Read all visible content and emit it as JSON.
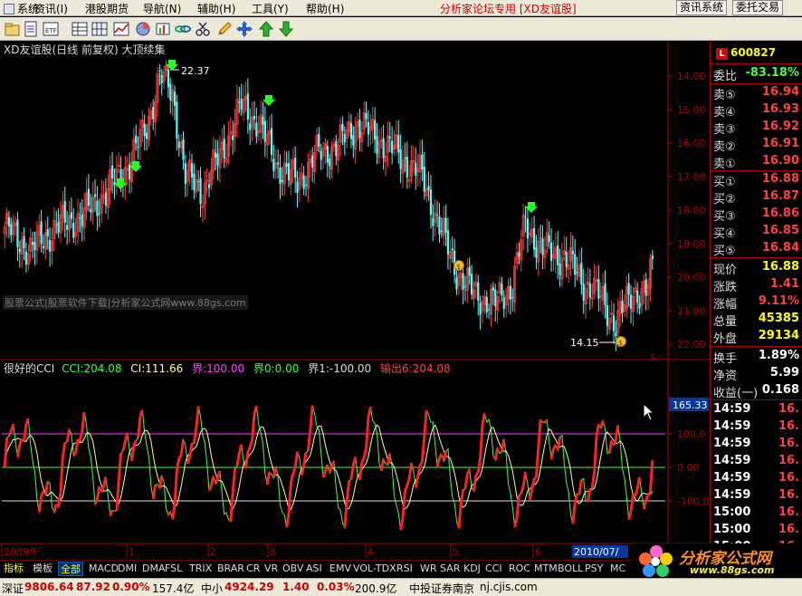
{
  "menu": {
    "items": [
      "系统",
      "资讯(I)",
      "港股期货",
      "导航(N)",
      "辅助(H)",
      "工具(Y)",
      "帮助(H)"
    ],
    "forum_text": "分析家论坛专用 [XD友谊股]",
    "right_buttons": [
      "资讯系统",
      "委托交易"
    ]
  },
  "toolbar": {
    "icons": [
      "folder-icon",
      "document-icon",
      "etf-icon",
      "table-icon",
      "grid-icon",
      "chart-icon",
      "chart-config-icon",
      "pencil-icon",
      "move-icon",
      "arrow-up-icon",
      "arrow-down-icon"
    ]
  },
  "chart": {
    "title": "XD友谊股(日线 前复权) 大顶续集",
    "y_ticks": [
      "22.00",
      "21.00",
      "20.00",
      "19.00",
      "18.00",
      "17.00",
      "16.00",
      "15.00",
      "14.00"
    ],
    "high_label": "22.37",
    "low_label": "14.15",
    "watermark": "股票公式|股票软件下载|分析家公式网www.88gs.com",
    "indicator": {
      "name": "很好的CCI",
      "cci": "CCI:204.08",
      "ci": "CI:111.66",
      "jie": "界:100.00",
      "jie0": "界0:0.00",
      "jie1": "界1:-100.00",
      "output": "输出6:204.08",
      "current_value": "165.33",
      "ticks": [
        "100.0",
        "0.00",
        "-100.0"
      ]
    },
    "x_labels": [
      "2009年",
      "1",
      "2",
      "3",
      "4",
      "5",
      "6",
      "2010/07/"
    ]
  },
  "chart_data": [
    {
      "type": "line",
      "title": "XD友谊股(日线 前复权) 大顶续集",
      "ylim": [
        13.8,
        22.6
      ],
      "yticks": [
        14,
        15,
        16,
        17,
        18,
        19,
        20,
        21,
        22
      ],
      "annotations": {
        "max": 22.37,
        "min": 14.15
      }
    },
    {
      "type": "line",
      "title": "很好的CCI",
      "series": [
        {
          "name": "CCI",
          "last": 204.08
        },
        {
          "name": "CI",
          "last": 111.66
        }
      ],
      "reference_lines": {
        "界": 100.0,
        "界0": 0.0,
        "界1": -100.0
      },
      "yticks": [
        100,
        0,
        -100
      ]
    }
  ],
  "quote": {
    "code": "600827",
    "weibi_label": "委比",
    "weibi_value": "-83.18%",
    "sell": [
      {
        "label": "卖⑤",
        "price": "16.94"
      },
      {
        "label": "卖④",
        "price": "16.93"
      },
      {
        "label": "卖③",
        "price": "16.92"
      },
      {
        "label": "卖②",
        "price": "16.91"
      },
      {
        "label": "卖①",
        "price": "16.90"
      }
    ],
    "buy": [
      {
        "label": "买①",
        "price": "16.88"
      },
      {
        "label": "买②",
        "price": "16.87"
      },
      {
        "label": "买③",
        "price": "16.86"
      },
      {
        "label": "买④",
        "price": "16.85"
      },
      {
        "label": "买⑤",
        "price": "16.84"
      }
    ],
    "stats": [
      {
        "label": "现价",
        "value": "16.88",
        "color": "#ffff00"
      },
      {
        "label": "涨跌",
        "value": "1.41",
        "color": "#ff4040"
      },
      {
        "label": "涨幅",
        "value": "9.11%",
        "color": "#ff4040"
      },
      {
        "label": "总量",
        "value": "45385",
        "color": "#ffff00"
      },
      {
        "label": "外盘",
        "value": "29134",
        "color": "#ffff00"
      },
      {
        "label": "换手",
        "value": "1.89%",
        "color": "#ffffff"
      },
      {
        "label": "净资",
        "value": "5.99",
        "color": "#ffffff"
      },
      {
        "label": "收益(一)",
        "value": "0.168",
        "color": "#ffffff"
      }
    ],
    "ticks": [
      {
        "time": "14:59",
        "price": "16."
      },
      {
        "time": "14:59",
        "price": "16."
      },
      {
        "time": "14:59",
        "price": "16."
      },
      {
        "time": "14:59",
        "price": "16."
      },
      {
        "time": "14:59",
        "price": "16."
      },
      {
        "time": "14:59",
        "price": "16."
      },
      {
        "time": "15:00",
        "price": "16."
      },
      {
        "time": "15:00",
        "price": "16."
      },
      {
        "time": "15:00",
        "price": "16."
      }
    ]
  },
  "tabs": [
    "指标",
    "模板",
    "全部",
    "MACD",
    "DMI",
    "DMA",
    "FSL",
    "TRIX",
    "BRAR",
    "CR",
    "VR",
    "OBV",
    "ASI",
    "EMV",
    "VOL-TDX",
    "RSI",
    "WR",
    "SAR",
    "KDJ",
    "CCI",
    "ROC",
    "MTM",
    "BOLL",
    "PSY",
    "MC"
  ],
  "status": {
    "sz_label": "深证",
    "sz_index": "9806.64",
    "sz_change": "87.92",
    "sz_pct": "0.90%",
    "sz_amount": "157.4亿",
    "zx_label": "中小",
    "zx_index": "4924.29",
    "zx_change": "1.40",
    "zx_pct": "0.03%",
    "zx_amount": "200.9亿",
    "broker": "中投证券南京",
    "site": "nj.cjis.com"
  },
  "logo": {
    "title": "分析家公式网",
    "url": "www.88gs.com"
  }
}
